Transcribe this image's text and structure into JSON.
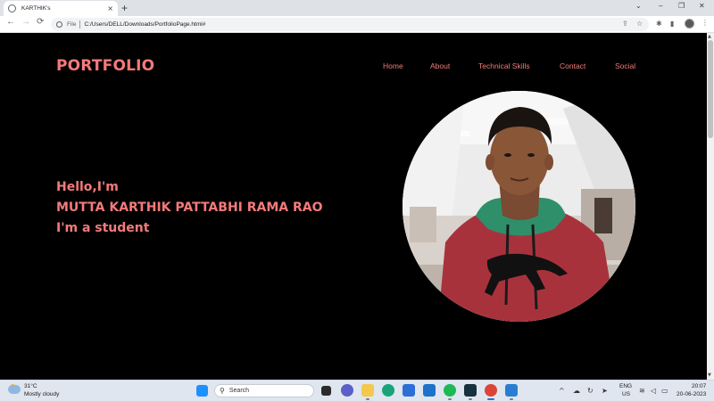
{
  "browser": {
    "tab_title": "KARTHIK's",
    "tab_close": "×",
    "new_tab": "+",
    "url_scheme_label": "File",
    "url": "C:/Users/DELL/Downloads/PortfolioPage.html#",
    "window_controls": {
      "chevron": "⌄",
      "minimize": "–",
      "restore": "❐",
      "close": "✕"
    },
    "nav": {
      "back": "←",
      "forward": "→",
      "reload": "⟳"
    },
    "toolbar_icons": {
      "share": "⇪",
      "star": "☆",
      "extensions": "✱",
      "sidepanel": "▮",
      "menu": "⋮"
    }
  },
  "page": {
    "logo": "PORTFOLIO",
    "nav": [
      "Home",
      "About",
      "Technical Skills",
      "Contact",
      "Social"
    ],
    "hero": {
      "line1": "Hello,I'm",
      "line2": "MUTTA KARTHIK PATTABHI RAMA RAO",
      "line3": "I'm a student"
    },
    "accent_color": "#f47a7a",
    "background_color": "#000000"
  },
  "taskbar": {
    "weather_temp": "31°C",
    "weather_desc": "Mostly cloudy",
    "search_label": "Search",
    "language_1": "ENG",
    "language_2": "US",
    "time": "20:07",
    "date": "20-06-2023",
    "tray_caret": "^"
  }
}
